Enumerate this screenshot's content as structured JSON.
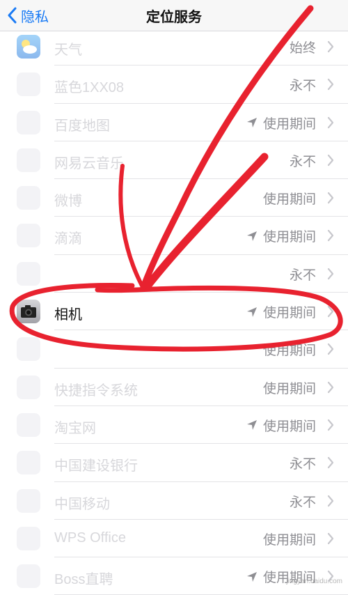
{
  "header": {
    "back_label": "隐私",
    "title": "定位服务"
  },
  "rows": [
    {
      "name": "天气",
      "status": "始终",
      "arrow": false,
      "icon": "weather-icon"
    },
    {
      "name": "蓝色1XX08",
      "status": "永不",
      "arrow": false,
      "icon": "app-icon"
    },
    {
      "name": "百度地图",
      "status": "使用期间",
      "arrow": true,
      "icon": "app-icon"
    },
    {
      "name": "网易云音乐",
      "status": "永不",
      "arrow": false,
      "icon": "app-icon"
    },
    {
      "name": "微博",
      "status": "使用期间",
      "arrow": false,
      "icon": "app-icon"
    },
    {
      "name": "滴滴",
      "status": "使用期间",
      "arrow": true,
      "icon": "app-icon"
    },
    {
      "name": "",
      "status": "永不",
      "arrow": false,
      "icon": "app-icon"
    },
    {
      "name": "相机",
      "status": "使用期间",
      "arrow": true,
      "icon": "camera-icon",
      "main": true
    },
    {
      "name": "",
      "status": "使用期间",
      "arrow": false,
      "icon": "app-icon"
    },
    {
      "name": "快捷指令系统",
      "status": "使用期间",
      "arrow": false,
      "icon": "app-icon"
    },
    {
      "name": "淘宝网",
      "status": "使用期间",
      "arrow": true,
      "icon": "app-icon"
    },
    {
      "name": "中国建设银行",
      "status": "永不",
      "arrow": false,
      "icon": "app-icon"
    },
    {
      "name": "中国移动",
      "status": "永不",
      "arrow": false,
      "icon": "app-icon"
    },
    {
      "name": "WPS Office",
      "status": "使用期间",
      "arrow": false,
      "icon": "app-icon"
    },
    {
      "name": "Boss直聘",
      "status": "使用期间",
      "arrow": true,
      "icon": "app-icon"
    }
  ],
  "watermark": "jingyan.baidu.com",
  "colors": {
    "accent": "#1a7bf5",
    "annotation": "#e8222f"
  }
}
